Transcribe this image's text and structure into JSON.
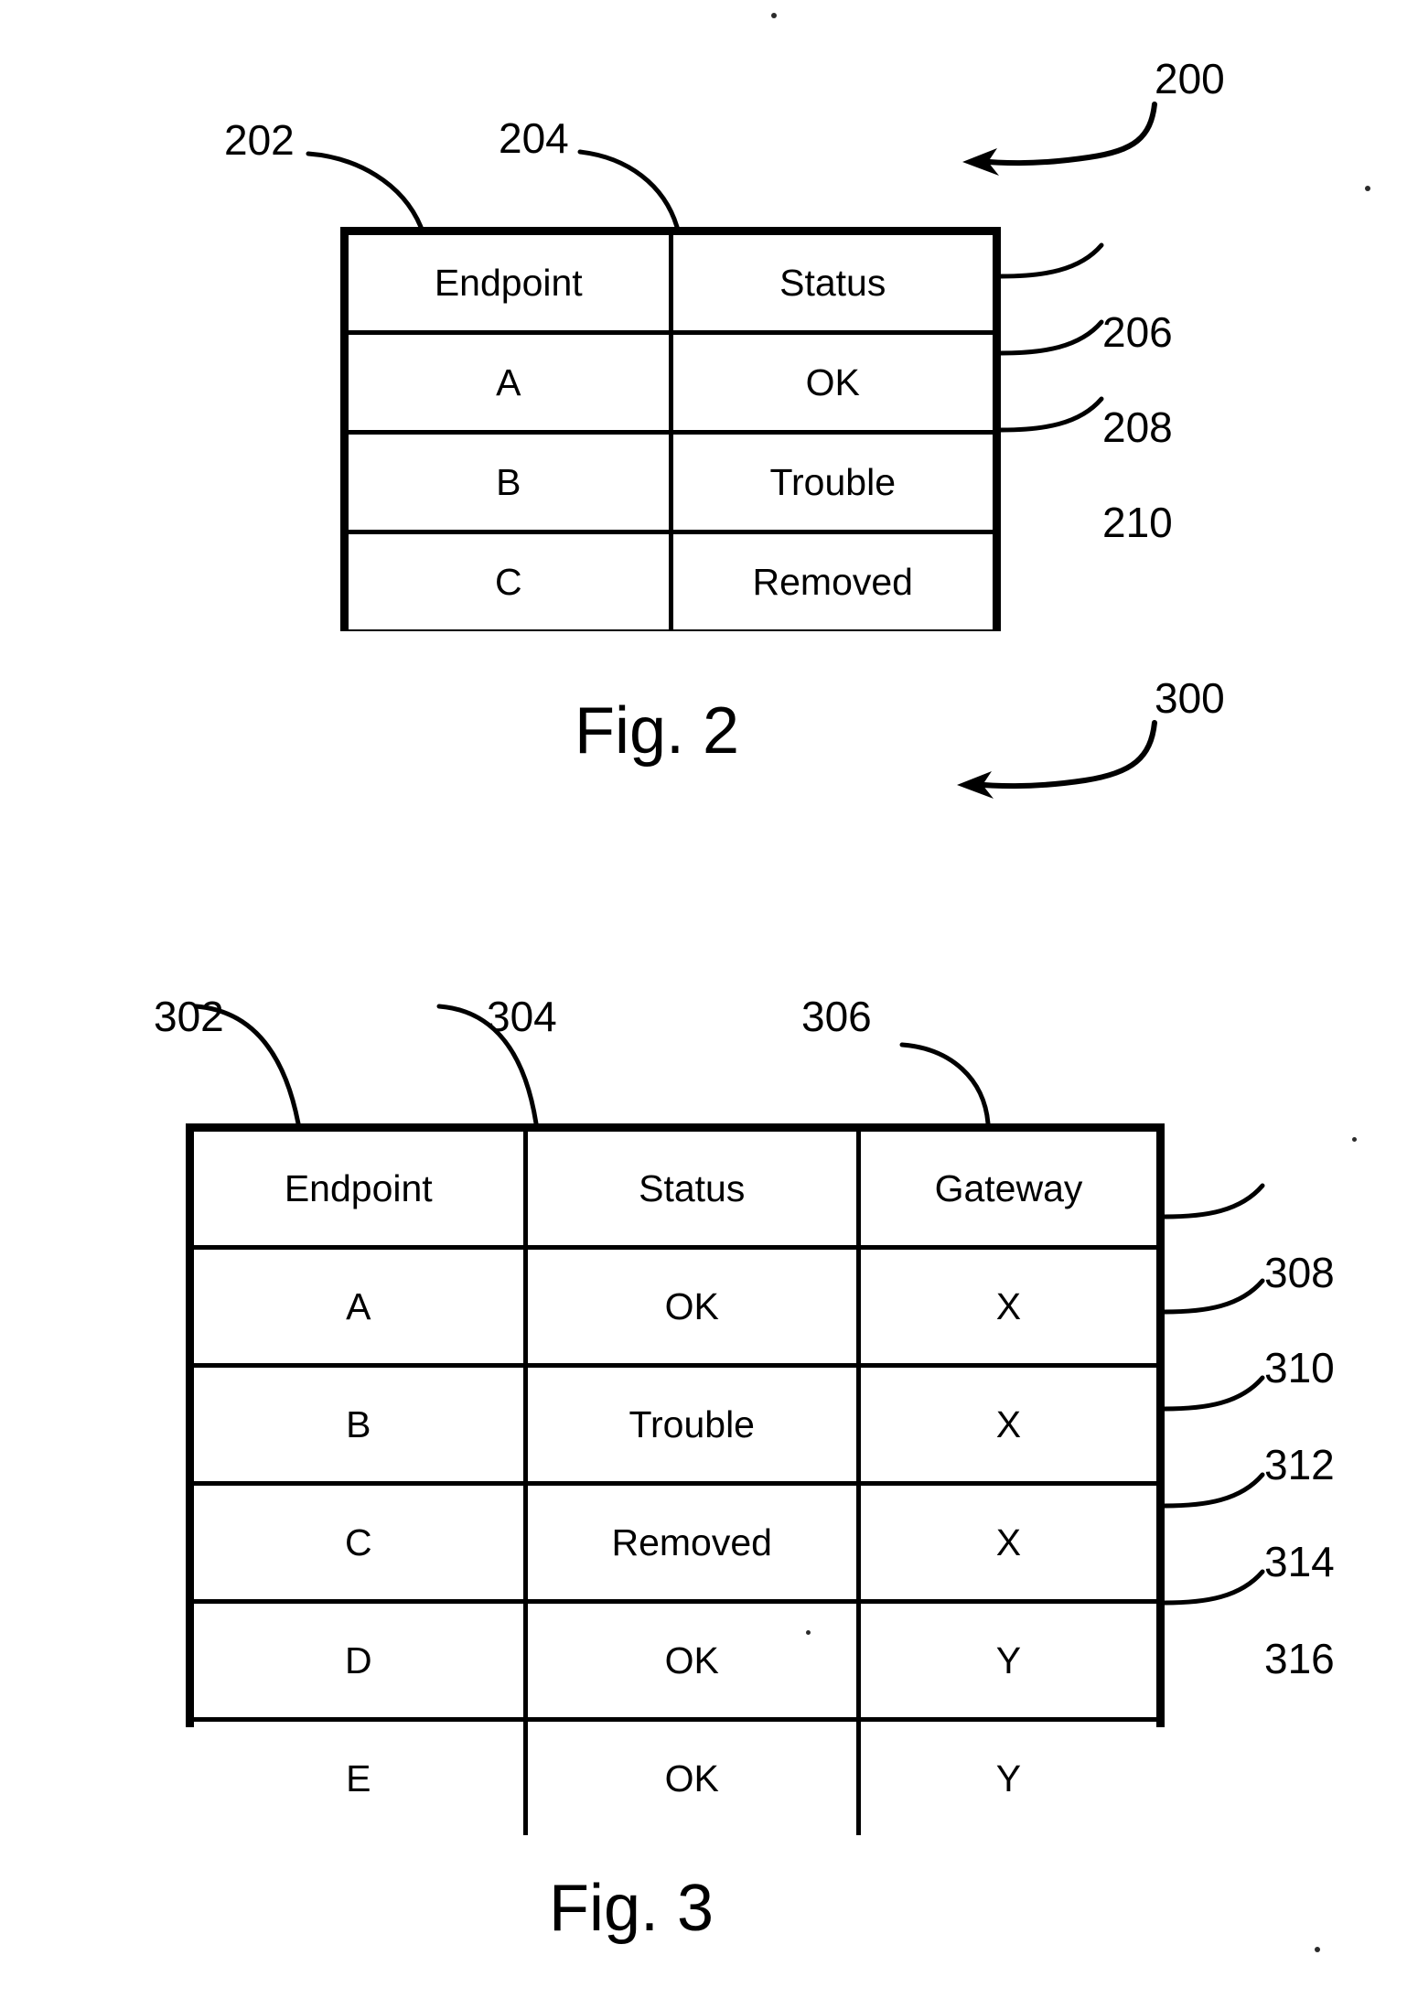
{
  "document": {
    "type": "patent-drawing-sheet",
    "figures": [
      "Fig. 2",
      "Fig. 3"
    ]
  },
  "figure2": {
    "caption": "Fig. 2",
    "figure_ref": "200",
    "table": {
      "ref_labels": {
        "column_endpoint": "202",
        "column_status": "204"
      },
      "columns": [
        "Endpoint",
        "Status"
      ],
      "rows": [
        {
          "endpoint": "A",
          "status": "OK",
          "ref": "206"
        },
        {
          "endpoint": "B",
          "status": "Trouble",
          "ref": "208"
        },
        {
          "endpoint": "C",
          "status": "Removed",
          "ref": "210"
        }
      ]
    }
  },
  "figure3": {
    "caption": "Fig. 3",
    "figure_ref": "300",
    "table": {
      "ref_labels": {
        "column_endpoint": "302",
        "column_status": "304",
        "column_gateway": "306"
      },
      "columns": [
        "Endpoint",
        "Status",
        "Gateway"
      ],
      "rows": [
        {
          "endpoint": "A",
          "status": "OK",
          "gateway": "X",
          "ref": "308"
        },
        {
          "endpoint": "B",
          "status": "Trouble",
          "gateway": "X",
          "ref": "310"
        },
        {
          "endpoint": "C",
          "status": "Removed",
          "gateway": "X",
          "ref": "312"
        },
        {
          "endpoint": "D",
          "status": "OK",
          "gateway": "Y",
          "ref": "314"
        },
        {
          "endpoint": "E",
          "status": "OK",
          "gateway": "Y",
          "ref": "316"
        }
      ]
    }
  },
  "colors": {
    "ink": "#000000",
    "paper": "#ffffff"
  }
}
